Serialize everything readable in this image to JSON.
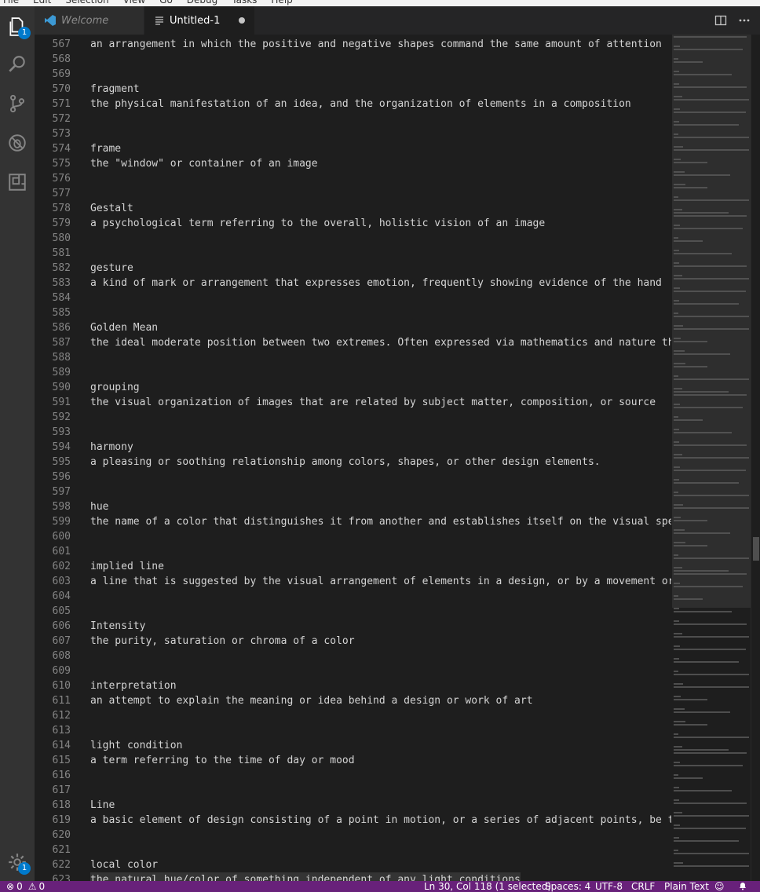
{
  "menu": [
    "File",
    "Edit",
    "Selection",
    "View",
    "Go",
    "Debug",
    "Tasks",
    "Help"
  ],
  "activity": {
    "explorer_badge": "1",
    "settings_badge": "1"
  },
  "tabs": [
    {
      "label": "Welcome"
    },
    {
      "label": "Untitled-1"
    }
  ],
  "editor": {
    "lines": [
      {
        "n": "567",
        "text": "an arrangement in which the positive and negative shapes command the same amount of attention"
      },
      {
        "n": "568",
        "text": ""
      },
      {
        "n": "569",
        "text": ""
      },
      {
        "n": "570",
        "text": "fragment"
      },
      {
        "n": "571",
        "text": "the physical manifestation of an idea, and the organization of elements in a composition"
      },
      {
        "n": "572",
        "text": ""
      },
      {
        "n": "573",
        "text": ""
      },
      {
        "n": "574",
        "text": "frame"
      },
      {
        "n": "575",
        "text": "the \"window\" or container of an image"
      },
      {
        "n": "576",
        "text": ""
      },
      {
        "n": "577",
        "text": ""
      },
      {
        "n": "578",
        "text": "Gestalt"
      },
      {
        "n": "579",
        "text": "a psychological term referring to the overall, holistic vision of an image"
      },
      {
        "n": "580",
        "text": ""
      },
      {
        "n": "581",
        "text": ""
      },
      {
        "n": "582",
        "text": "gesture"
      },
      {
        "n": "583",
        "text": "a kind of mark or arrangement that expresses emotion, frequently showing evidence of the hand"
      },
      {
        "n": "584",
        "text": ""
      },
      {
        "n": "585",
        "text": ""
      },
      {
        "n": "586",
        "text": "Golden Mean"
      },
      {
        "n": "587",
        "text": "the ideal moderate position between two extremes. Often expressed via mathematics and nature thro"
      },
      {
        "n": "588",
        "text": ""
      },
      {
        "n": "589",
        "text": ""
      },
      {
        "n": "590",
        "text": "grouping"
      },
      {
        "n": "591",
        "text": "the visual organization of images that are related by subject matter, composition, or source"
      },
      {
        "n": "592",
        "text": ""
      },
      {
        "n": "593",
        "text": ""
      },
      {
        "n": "594",
        "text": "harmony"
      },
      {
        "n": "595",
        "text": "a pleasing or soothing relationship among colors, shapes, or other design elements."
      },
      {
        "n": "596",
        "text": ""
      },
      {
        "n": "597",
        "text": ""
      },
      {
        "n": "598",
        "text": "hue"
      },
      {
        "n": "599",
        "text": "the name of a color that distinguishes it from another and establishes itself on the visual spect"
      },
      {
        "n": "600",
        "text": ""
      },
      {
        "n": "601",
        "text": ""
      },
      {
        "n": "602",
        "text": "implied line"
      },
      {
        "n": "603",
        "text": "a line that is suggested by the visual arrangement of elements in a design, or by a movement or g"
      },
      {
        "n": "604",
        "text": ""
      },
      {
        "n": "605",
        "text": ""
      },
      {
        "n": "606",
        "text": "Intensity"
      },
      {
        "n": "607",
        "text": "the purity, saturation or chroma of a color"
      },
      {
        "n": "608",
        "text": ""
      },
      {
        "n": "609",
        "text": ""
      },
      {
        "n": "610",
        "text": "interpretation"
      },
      {
        "n": "611",
        "text": "an attempt to explain the meaning or idea behind a design or work of art"
      },
      {
        "n": "612",
        "text": ""
      },
      {
        "n": "613",
        "text": ""
      },
      {
        "n": "614",
        "text": "light condition"
      },
      {
        "n": "615",
        "text": "a term referring to the time of day or mood"
      },
      {
        "n": "616",
        "text": ""
      },
      {
        "n": "617",
        "text": ""
      },
      {
        "n": "618",
        "text": "Line"
      },
      {
        "n": "619",
        "text": "a basic element of design consisting of a point in motion, or a series of adjacent points, be the"
      },
      {
        "n": "620",
        "text": ""
      },
      {
        "n": "621",
        "text": ""
      },
      {
        "n": "622",
        "text": "local color"
      },
      {
        "n": "623",
        "text": "the natural hue/color of something independent of any light conditions"
      }
    ]
  },
  "status": {
    "errors": "0",
    "warnings": "0",
    "position": "Ln 30, Col 118 (1 selected)",
    "spaces": "Spaces: 4",
    "encoding": "UTF-8",
    "eol": "CRLF",
    "language": "Plain Text"
  },
  "colors": {
    "statusbar": "#68217a",
    "activitybar": "#333333",
    "editor_bg": "#1e1e1e",
    "badge": "#007acc"
  }
}
